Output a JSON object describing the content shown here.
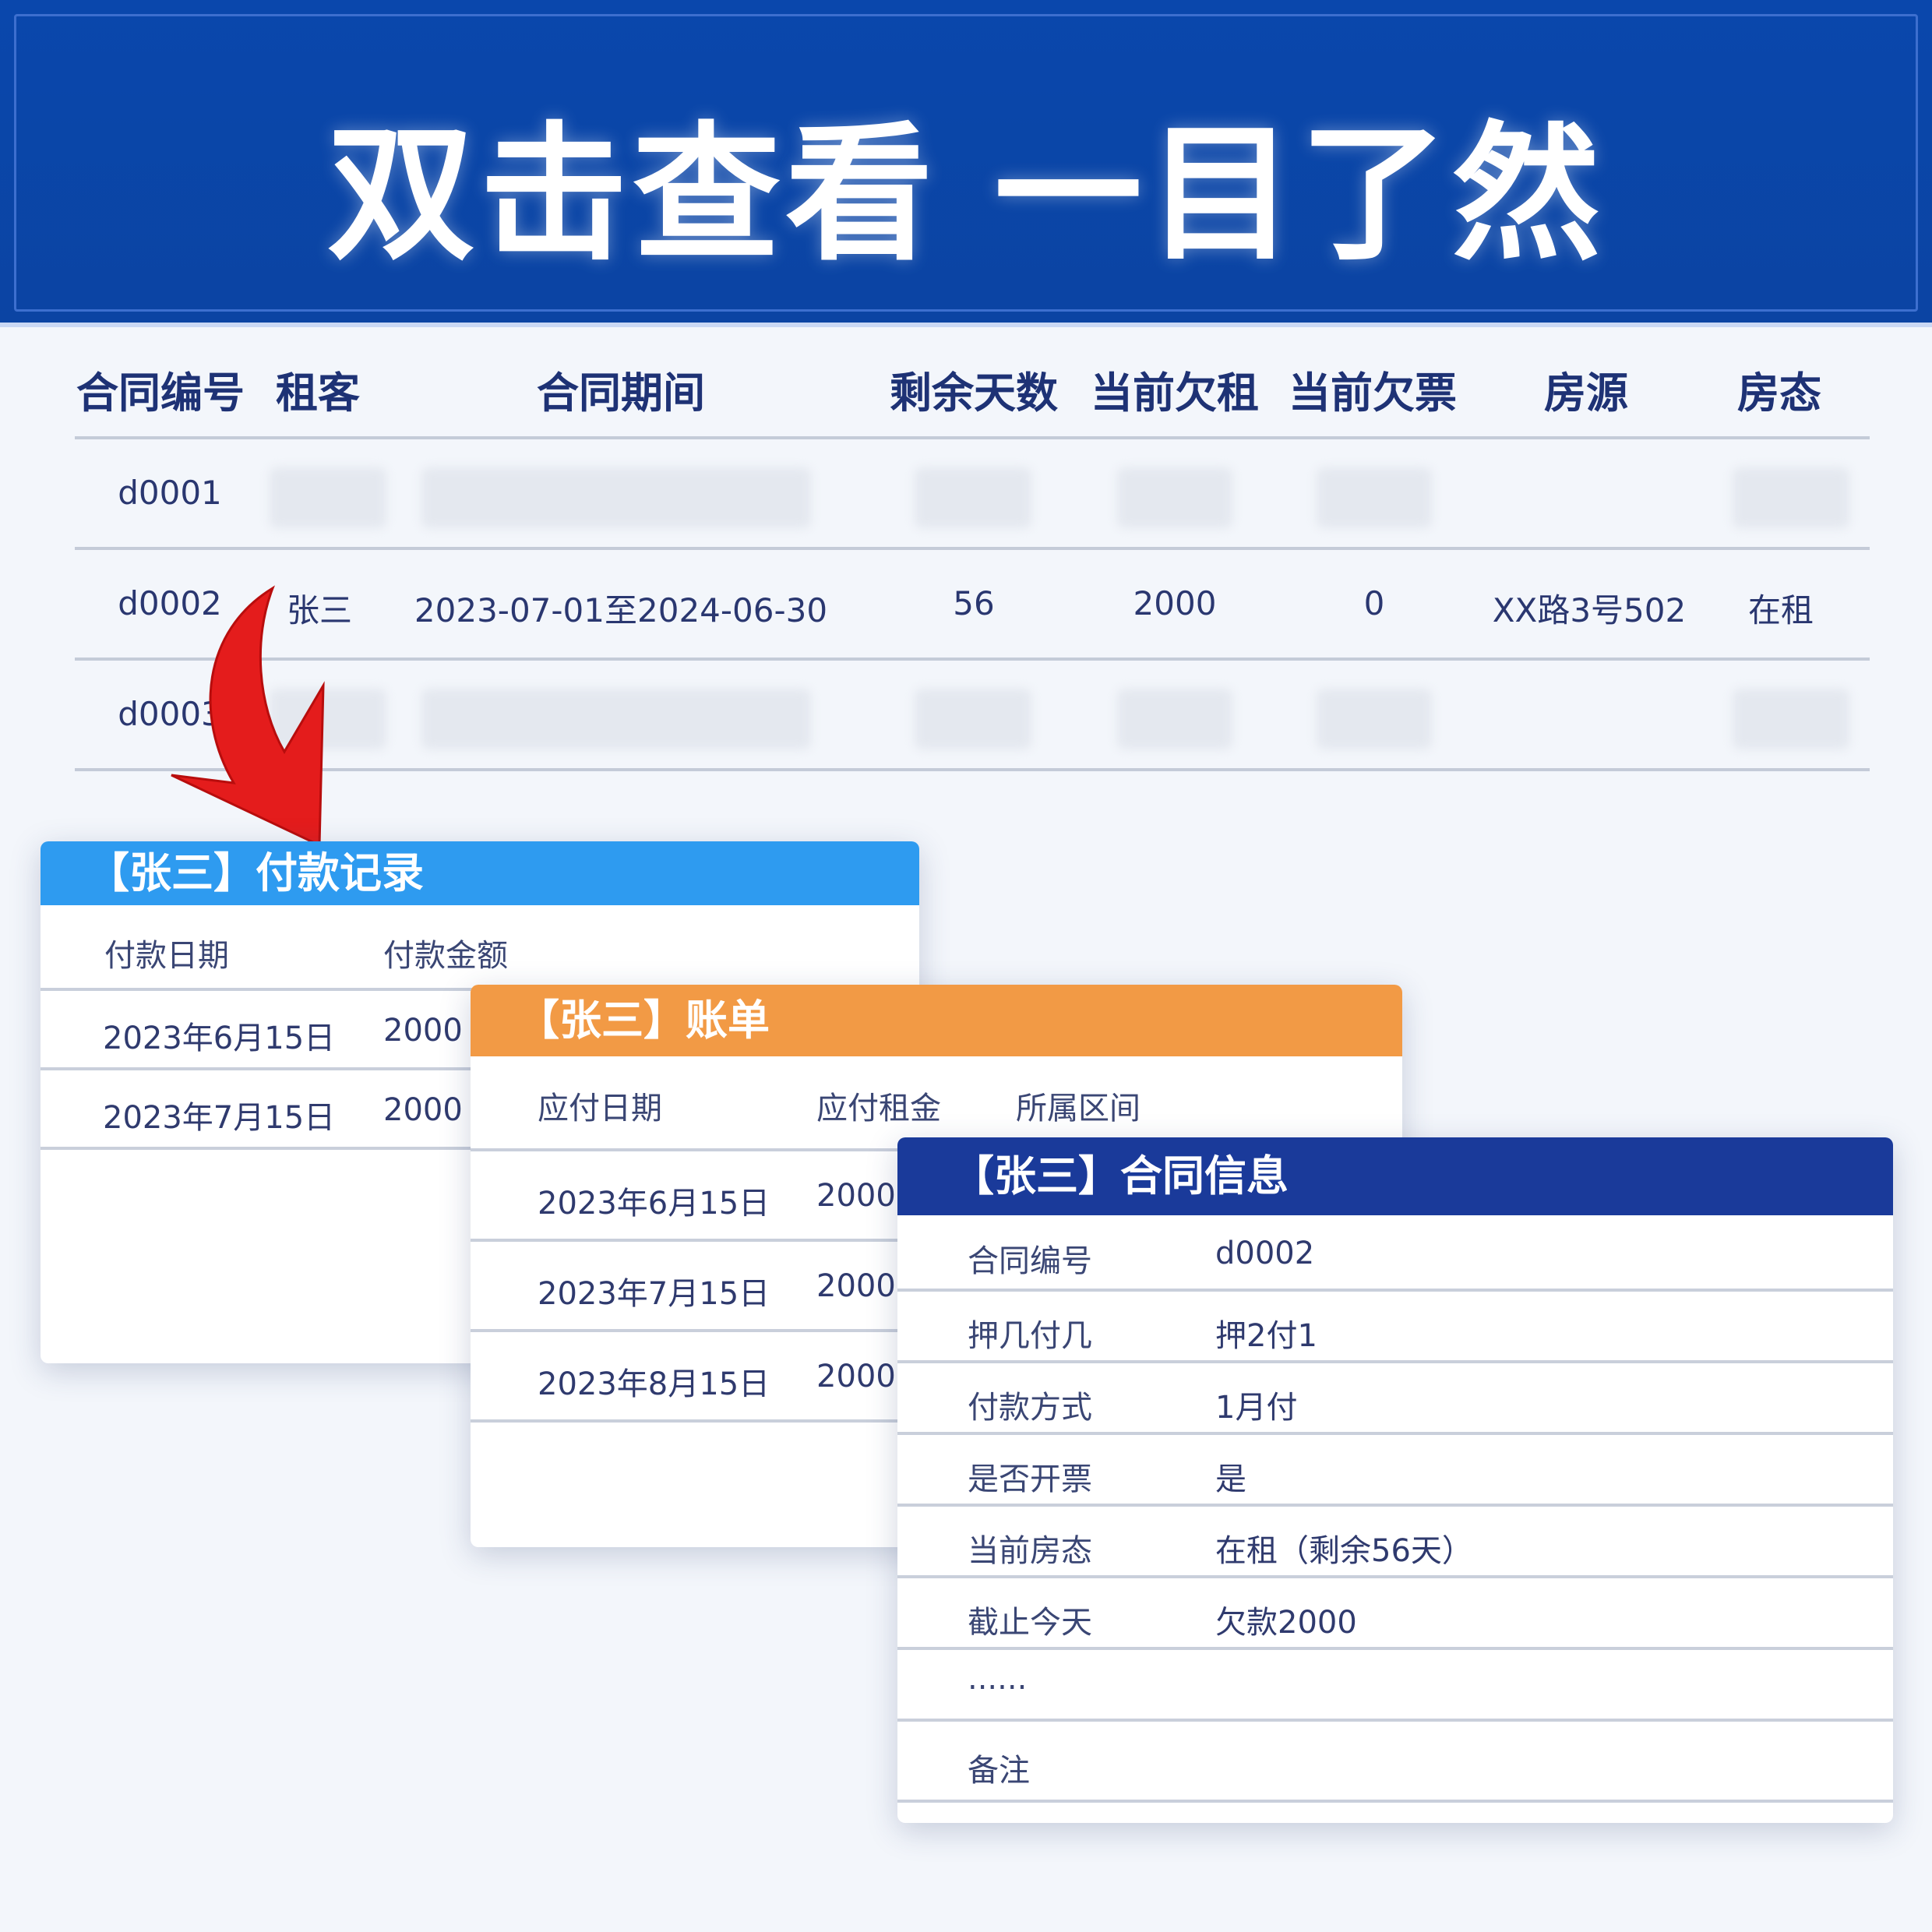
{
  "banner": {
    "title": "双击查看 一目了然"
  },
  "table": {
    "headers": [
      "合同编号",
      "租客",
      "合同期间",
      "剩余天数",
      "当前欠租",
      "当前欠票",
      "房源",
      "房态"
    ],
    "rows": [
      {
        "id": "d0001"
      },
      {
        "id": "d0002",
        "tenant": "张三",
        "period": "2023-07-01至2024-06-30",
        "days_left": "56",
        "rent_due": "2000",
        "invoice_due": "0",
        "property": "XX路3号502",
        "status": "在租"
      },
      {
        "id": "d0003"
      }
    ]
  },
  "payments": {
    "title": "【张三】付款记录",
    "headers": [
      "付款日期",
      "付款金额"
    ],
    "rows": [
      {
        "date": "2023年6月15日",
        "amount": "2000"
      },
      {
        "date": "2023年7月15日",
        "amount": "2000"
      }
    ]
  },
  "bills": {
    "title": "【张三】账单",
    "headers": [
      "应付日期",
      "应付租金",
      "所属区间"
    ],
    "rows": [
      {
        "date": "2023年6月15日",
        "amount": "2000"
      },
      {
        "date": "2023年7月15日",
        "amount": "2000"
      },
      {
        "date": "2023年8月15日",
        "amount": "2000"
      }
    ]
  },
  "contract": {
    "title": "【张三】合同信息",
    "rows": [
      {
        "label": "合同编号",
        "value": "d0002"
      },
      {
        "label": "押几付几",
        "value": "押2付1"
      },
      {
        "label": "付款方式",
        "value": "1月付"
      },
      {
        "label": "是否开票",
        "value": "是"
      },
      {
        "label": "当前房态",
        "value": "在租（剩余56天）"
      },
      {
        "label": "截止今天",
        "value": "欠款2000"
      },
      {
        "label": "......",
        "value": ""
      },
      {
        "label": "备注",
        "value": ""
      }
    ]
  },
  "colors": {
    "banner": "#0a47ac",
    "payments_head": "#2e9bf0",
    "bills_head": "#f29a45",
    "contract_head": "#1a3a9a",
    "arrow": "#e41c1c"
  }
}
